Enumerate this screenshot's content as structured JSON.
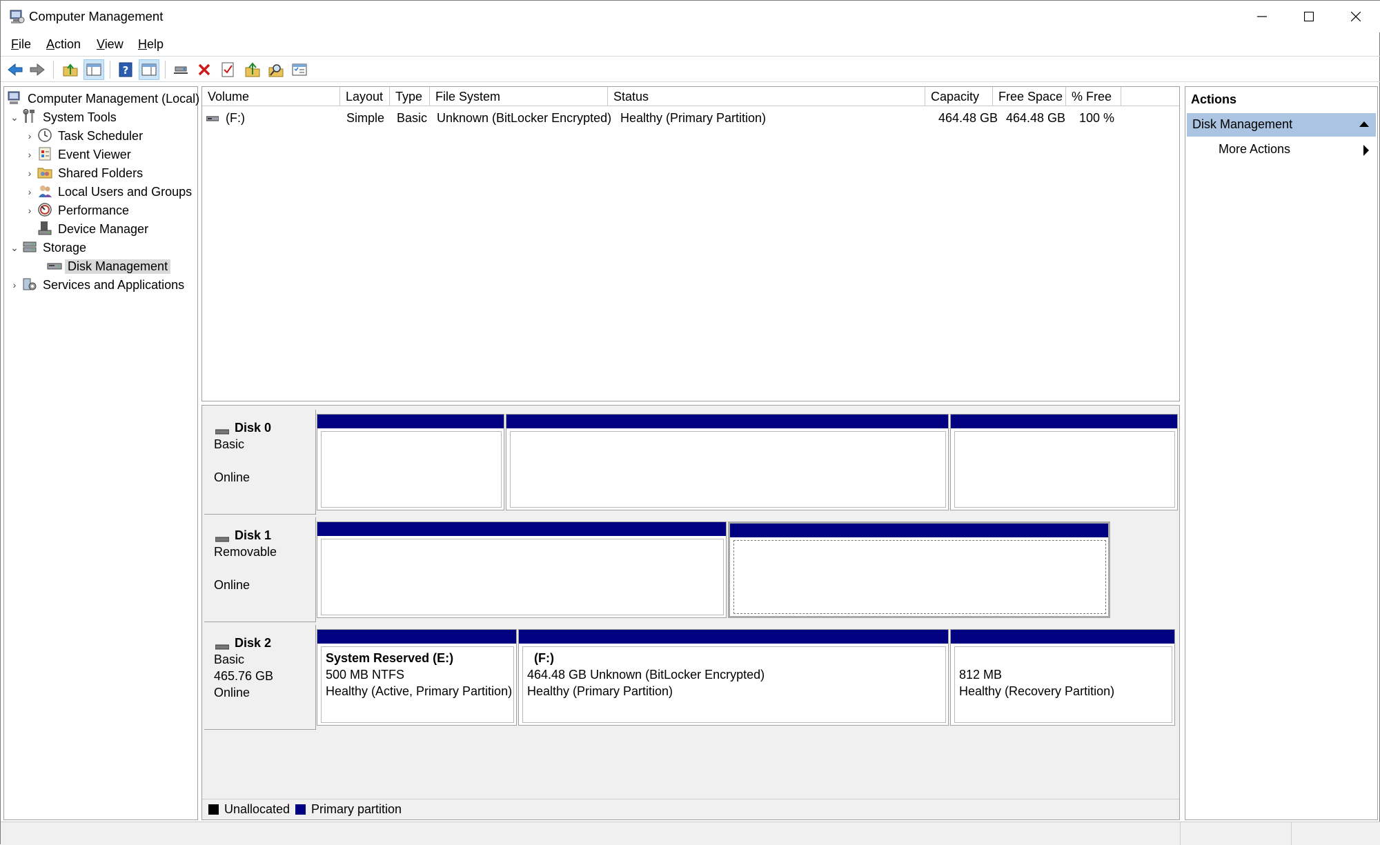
{
  "window": {
    "title": "Computer Management"
  },
  "menu": [
    {
      "label": "File",
      "accel": "F",
      "rest": "ile"
    },
    {
      "label": "Action",
      "accel": "A",
      "rest": "ction"
    },
    {
      "label": "View",
      "accel": "V",
      "rest": "iew"
    },
    {
      "label": "Help",
      "accel": "H",
      "rest": "elp"
    }
  ],
  "toolbar": [
    "back-icon",
    "forward-icon",
    "up-folder-icon",
    "show-hide-tree-icon",
    "help-icon",
    "show-hide-action-pane-icon",
    "connect-icon",
    "delete-icon",
    "properties-icon",
    "open-folder-icon",
    "search-icon",
    "settings-icon"
  ],
  "tree": {
    "root": "Computer Management (Local)",
    "system_tools": "System Tools",
    "task_scheduler": "Task Scheduler",
    "event_viewer": "Event Viewer",
    "shared_folders": "Shared Folders",
    "local_users": "Local Users and Groups",
    "performance": "Performance",
    "device_manager": "Device Manager",
    "storage": "Storage",
    "disk_management": "Disk Management",
    "services": "Services and Applications"
  },
  "volumes": {
    "columns": [
      "Volume",
      "Layout",
      "Type",
      "File System",
      "Status",
      "Capacity",
      "Free Space",
      "% Free"
    ],
    "rows": [
      {
        "volume": "(F:)",
        "layout": "Simple",
        "type": "Basic",
        "fs": "Unknown (BitLocker Encrypted)",
        "status": "Healthy (Primary Partition)",
        "capacity": "464.48 GB",
        "free": "464.48 GB",
        "pct": "100 %"
      }
    ]
  },
  "disks": {
    "disk0": {
      "name": "Disk 0",
      "type": "Basic",
      "size": "",
      "state": "Online"
    },
    "disk1": {
      "name": "Disk 1",
      "type": "Removable",
      "size": "",
      "state": "Online"
    },
    "disk2": {
      "name": "Disk 2",
      "type": "Basic",
      "size": "465.76 GB",
      "state": "Online",
      "p1": {
        "title": "System Reserved  (E:)",
        "line1": "500 MB NTFS",
        "line2": "Healthy (Active, Primary Partition)"
      },
      "p2": {
        "title": "(F:)",
        "line1": "464.48 GB Unknown (BitLocker Encrypted)",
        "line2": "Healthy (Primary Partition)"
      },
      "p3": {
        "title": "",
        "line1": "812 MB",
        "line2": "Healthy (Recovery Partition)"
      }
    }
  },
  "legend": {
    "unallocated": "Unallocated",
    "primary": "Primary partition",
    "unallocated_color": "#000000",
    "primary_color": "#000080"
  },
  "actions": {
    "header": "Actions",
    "selected": "Disk Management",
    "more": "More Actions"
  }
}
